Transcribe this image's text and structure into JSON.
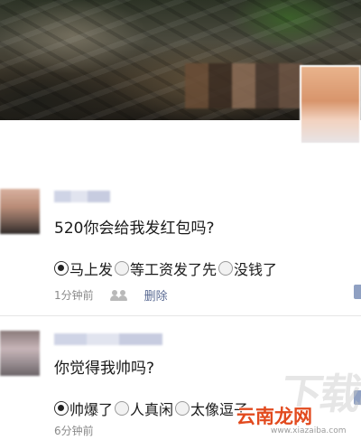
{
  "feed": {
    "posts": [
      {
        "message": "520你会给我发红包吗?",
        "options": [
          {
            "label": "马上发",
            "checked": true
          },
          {
            "label": "等工资发了先",
            "checked": false
          },
          {
            "label": "没钱了",
            "checked": false
          }
        ],
        "time": "1分钟前",
        "delete_label": "删除"
      },
      {
        "message": "你觉得我帅吗?",
        "options": [
          {
            "label": "帅爆了",
            "checked": true
          },
          {
            "label": "人真闲",
            "checked": false
          },
          {
            "label": "太像逗子",
            "checked": false
          }
        ],
        "time": "6分钟前"
      }
    ]
  },
  "watermark": {
    "big_text": "下载吧",
    "brand": "云南龙网",
    "url": "www.xiazaiba.com"
  },
  "colors": {
    "link": "#5b6b93",
    "brand_red": "#e24a1e"
  }
}
